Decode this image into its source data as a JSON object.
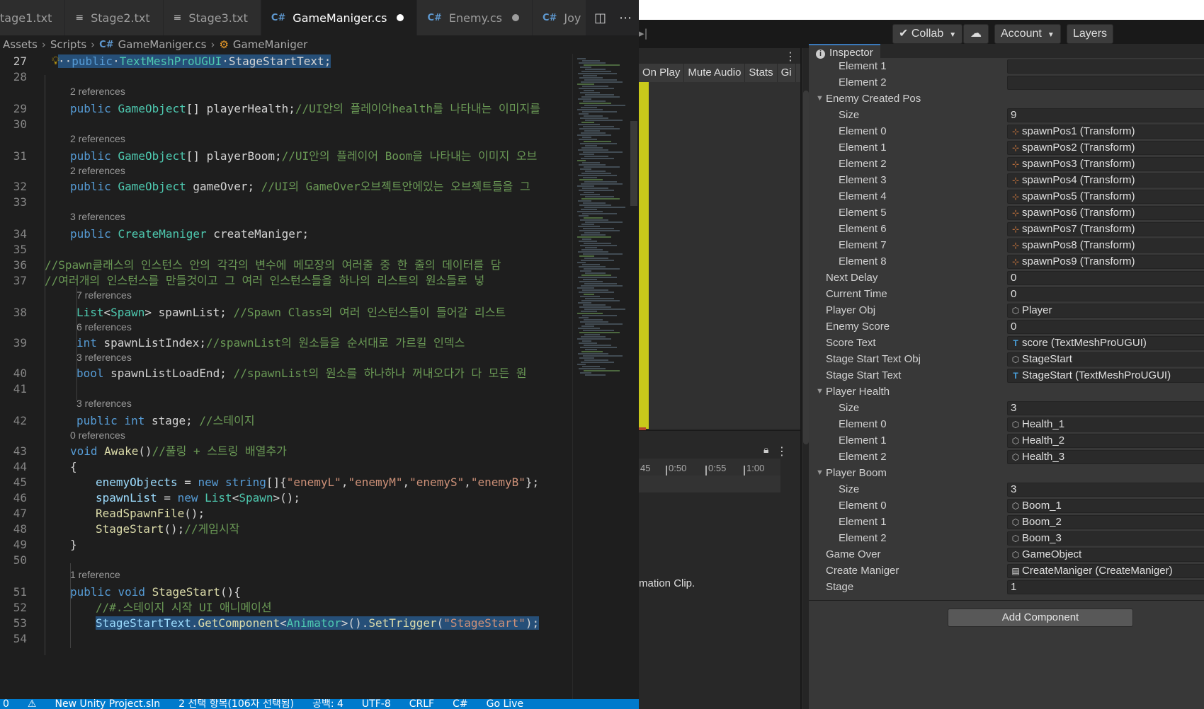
{
  "vscode": {
    "tabs": [
      {
        "label": "tage1.txt",
        "icon": "text-file-icon",
        "modified": false,
        "active": false
      },
      {
        "label": "Stage2.txt",
        "icon": "text-file-icon",
        "modified": false,
        "active": false
      },
      {
        "label": "Stage3.txt",
        "icon": "text-file-icon",
        "modified": false,
        "active": false
      },
      {
        "label": "GameManiger.cs",
        "icon": "csharp-file-icon",
        "modified": true,
        "active": true
      },
      {
        "label": "Enemy.cs",
        "icon": "csharp-file-icon",
        "modified": true,
        "active": false
      },
      {
        "label": "Joy",
        "icon": "csharp-file-icon",
        "modified": false,
        "active": false
      }
    ],
    "tab_icon_glyphs": {
      "txt": "≡",
      "cs": "C#"
    },
    "breadcrumb": {
      "root": "Assets",
      "folder": "Scripts",
      "file": "GameManiger.cs",
      "symbol": "GameManiger"
    },
    "lines": [
      {
        "num": "27",
        "lens": "",
        "html": "<span class=\"sel\">··<span class=\"kw\">public</span>·<span class=\"ty\">TextMeshProUGUI</span>·StageStartText;</span>",
        "indent": 82
      },
      {
        "num": "28",
        "lens": "",
        "html": "",
        "indent": 82
      },
      {
        "num": "29",
        "lens": "2 references",
        "html": "<span class=\"kw\">public</span> <span class=\"ty\">GameObject</span>[] playerHealth;<span class=\"cm\">//UI안의 플레이어health를 나타내는 이미지를</span>",
        "indent": 99
      },
      {
        "num": "30",
        "lens": "",
        "html": "",
        "indent": 99
      },
      {
        "num": "31",
        "lens": "2 references",
        "html": "<span class=\"kw\">public</span> <span class=\"ty\">GameObject</span>[] playerBoom;<span class=\"cm\">//UI안의 플레이어 Boom을 나타내는 이미지 오브</span>",
        "indent": 99
      },
      {
        "num": "32",
        "lens": "2 references",
        "html": "<span class=\"kw\">public</span> <span class=\"ty\">GameObject</span> gameOver; <span class=\"cm\">//UI의 GameOver오브젝트안에있는 오브젝트들을 그</span>",
        "indent": 99
      },
      {
        "num": "33",
        "lens": "",
        "html": "",
        "indent": 99
      },
      {
        "num": "34",
        "lens": "3 references",
        "html": "<span class=\"kw\">public</span> <span class=\"ty\">CreateManiger</span> createManiger;",
        "indent": 99
      },
      {
        "num": "35",
        "lens": "",
        "html": "",
        "indent": 99
      },
      {
        "num": "36",
        "lens": "",
        "html": "<span class=\"cm\">//Spawn클래스의 인스턴스 안의 각각의 변수에 메모장의 여러줄 중 한 줄의 데이터를 담</span>",
        "indent": 63
      },
      {
        "num": "37",
        "lens": "",
        "html": "<span class=\"cm\">//여러개의 인스턴스를 만들것이고 그 여러 인스턴스들을 하나의 리스트의 원소들로 넣</span>",
        "indent": 63
      },
      {
        "num": "38",
        "lens": "7 references",
        "html": "<span class=\"ty\">List</span>&lt;<span class=\"ty\">Spawn</span>&gt; spawnList; <span class=\"cm\">//Spawn Class의 여러 인스턴스들이 들어갈 리스트</span>",
        "indent": 108
      },
      {
        "num": "39",
        "lens": "6 references",
        "html": "<span class=\"kw\">int</span> spawnListIndex;<span class=\"cm\">//spawnList의 원소들을 순서대로 가르킬 인덱스</span>",
        "indent": 108
      },
      {
        "num": "40",
        "lens": "3 references",
        "html": "<span class=\"kw\">bool</span> spawnListLoadEnd; <span class=\"cm\">//spawnList의 원소를 하나하나 꺼내오다가 다 모든 원</span>",
        "indent": 108
      },
      {
        "num": "41",
        "lens": "",
        "html": "",
        "indent": 108
      },
      {
        "num": "42",
        "lens": "3 references",
        "html": "<span class=\"kw\">public</span> <span class=\"kw\">int</span> stage; <span class=\"cm\">//스테이지</span>",
        "indent": 108
      },
      {
        "num": "43",
        "lens": "0 references",
        "html": "<span class=\"kw\">void</span> <span class=\"fn\">Awake</span>()<span class=\"cm\">//풀링 + 스트링 배열추가</span>",
        "indent": 99
      },
      {
        "num": "44",
        "lens": "",
        "html": "{",
        "indent": 99
      },
      {
        "num": "45",
        "lens": "",
        "html": "<span class=\"vr\">enemyObjects</span> = <span class=\"kw\">new</span> <span class=\"kw\">string</span>[]{<span class=\"st\">\"enemyL\"</span>,<span class=\"st\">\"enemyM\"</span>,<span class=\"st\">\"enemyS\"</span>,<span class=\"st\">\"enemyB\"</span>};",
        "indent": 135
      },
      {
        "num": "46",
        "lens": "",
        "html": "<span class=\"vr\">spawnList</span> = <span class=\"kw\">new</span> <span class=\"ty\">List</span>&lt;<span class=\"ty\">Spawn</span>&gt;();",
        "indent": 135
      },
      {
        "num": "47",
        "lens": "",
        "html": "<span class=\"fn\">ReadSpawnFile</span>();",
        "indent": 135
      },
      {
        "num": "48",
        "lens": "",
        "html": "<span class=\"fn\">StageStart</span>();<span class=\"cm\">//게임시작</span>",
        "indent": 135
      },
      {
        "num": "49",
        "lens": "",
        "html": "}",
        "indent": 99
      },
      {
        "num": "50",
        "lens": "",
        "html": "",
        "indent": 99
      },
      {
        "num": "51",
        "lens": "1 reference",
        "html": "<span class=\"kw\">public</span> <span class=\"kw\">void</span> <span class=\"fn\">StageStart</span>(){",
        "indent": 99
      },
      {
        "num": "52",
        "lens": "",
        "html": "<span class=\"cm\">//#.스테이지 시작 UI 애니메이션</span>",
        "indent": 135
      },
      {
        "num": "53",
        "lens": "",
        "html": "<span class=\"sel\"><span class=\"vr\">StageStartText</span>.<span class=\"fn\">GetComponent</span>&lt;<span class=\"ty\">Animator</span>&gt;().<span class=\"fn\">SetTrigger</span>(<span class=\"st\">\"StageStart\"</span>);</span>",
        "indent": 135
      },
      {
        "num": "54",
        "lens": "",
        "html": "",
        "indent": 135
      }
    ],
    "status_items": [
      "0",
      "⚠",
      "New Unity Project.sln",
      "2 선택 항목(106자 선택됨)",
      "공백: 4",
      "UTF-8",
      "CRLF",
      "C#",
      "Go Live"
    ]
  },
  "unity": {
    "toolbar": {
      "collab": "Collab",
      "account": "Account",
      "layers": "Layers"
    },
    "game_toolbar": [
      "On Play",
      "Mute Audio",
      "Stats",
      "Gi"
    ],
    "timeline_ticks": [
      "45",
      "0:50",
      "0:55",
      "1:00"
    ],
    "animation_message": "mation Clip.",
    "inspector_tab": "Inspector",
    "properties": [
      {
        "label": "Element 1",
        "value": "",
        "depth": 2,
        "foldout": false,
        "icon": ""
      },
      {
        "label": "Element 2",
        "value": "",
        "depth": 2,
        "foldout": false,
        "icon": ""
      },
      {
        "label": "Enemy Created Pos",
        "value": null,
        "depth": 1,
        "foldout": true,
        "icon": ""
      },
      {
        "label": "Size",
        "value": "9",
        "depth": 2,
        "foldout": false,
        "icon": ""
      },
      {
        "label": "Element 0",
        "value": "spawnPos1 (Transform)",
        "depth": 2,
        "foldout": false,
        "icon": "transform"
      },
      {
        "label": "Element 1",
        "value": "spawnPos2 (Transform)",
        "depth": 2,
        "foldout": false,
        "icon": "transform"
      },
      {
        "label": "Element 2",
        "value": "spawnPos3 (Transform)",
        "depth": 2,
        "foldout": false,
        "icon": "transform"
      },
      {
        "label": "Element 3",
        "value": "spawnPos4 (Transform)",
        "depth": 2,
        "foldout": false,
        "icon": "transform"
      },
      {
        "label": "Element 4",
        "value": "spawnPos5 (Transform)",
        "depth": 2,
        "foldout": false,
        "icon": "transform"
      },
      {
        "label": "Element 5",
        "value": "spawnPos6 (Transform)",
        "depth": 2,
        "foldout": false,
        "icon": "transform"
      },
      {
        "label": "Element 6",
        "value": "spawnPos7 (Transform)",
        "depth": 2,
        "foldout": false,
        "icon": "transform"
      },
      {
        "label": "Element 7",
        "value": "spawnPos8 (Transform)",
        "depth": 2,
        "foldout": false,
        "icon": "transform"
      },
      {
        "label": "Element 8",
        "value": "spawnPos9 (Transform)",
        "depth": 2,
        "foldout": false,
        "icon": "transform"
      },
      {
        "label": "Next Delay",
        "value": "0",
        "depth": 1,
        "foldout": false,
        "icon": ""
      },
      {
        "label": "Current Time",
        "value": "0",
        "depth": 1,
        "foldout": false,
        "icon": ""
      },
      {
        "label": "Player Obj",
        "value": "Player",
        "depth": 1,
        "foldout": false,
        "icon": "gameobject"
      },
      {
        "label": "Enemy Score",
        "value": "0",
        "depth": 1,
        "foldout": false,
        "icon": ""
      },
      {
        "label": "Score Text",
        "value": "score (TextMeshProUGUI)",
        "depth": 1,
        "foldout": false,
        "icon": "textmesh"
      },
      {
        "label": "Stage Start Text Obj",
        "value": "StageStart",
        "depth": 1,
        "foldout": false,
        "icon": "gameobject"
      },
      {
        "label": "Stage Start Text",
        "value": "StageStart (TextMeshProUGUI)",
        "depth": 1,
        "foldout": false,
        "icon": "textmesh"
      },
      {
        "label": "Player Health",
        "value": null,
        "depth": 1,
        "foldout": true,
        "icon": ""
      },
      {
        "label": "Size",
        "value": "3",
        "depth": 2,
        "foldout": false,
        "icon": ""
      },
      {
        "label": "Element 0",
        "value": "Health_1",
        "depth": 2,
        "foldout": false,
        "icon": "gameobject"
      },
      {
        "label": "Element 1",
        "value": "Health_2",
        "depth": 2,
        "foldout": false,
        "icon": "gameobject"
      },
      {
        "label": "Element 2",
        "value": "Health_3",
        "depth": 2,
        "foldout": false,
        "icon": "gameobject"
      },
      {
        "label": "Player Boom",
        "value": null,
        "depth": 1,
        "foldout": true,
        "icon": ""
      },
      {
        "label": "Size",
        "value": "3",
        "depth": 2,
        "foldout": false,
        "icon": ""
      },
      {
        "label": "Element 0",
        "value": "Boom_1",
        "depth": 2,
        "foldout": false,
        "icon": "gameobject"
      },
      {
        "label": "Element 1",
        "value": "Boom_2",
        "depth": 2,
        "foldout": false,
        "icon": "gameobject"
      },
      {
        "label": "Element 2",
        "value": "Boom_3",
        "depth": 2,
        "foldout": false,
        "icon": "gameobject"
      },
      {
        "label": "Game Over",
        "value": "GameObject",
        "depth": 1,
        "foldout": false,
        "icon": "gameobject"
      },
      {
        "label": "Create Maniger",
        "value": "CreateManiger (CreateManiger)",
        "depth": 1,
        "foldout": false,
        "icon": "script"
      },
      {
        "label": "Stage",
        "value": "1",
        "depth": 1,
        "foldout": false,
        "icon": ""
      }
    ],
    "add_component": "Add Component",
    "icon_glyphs": {
      "transform": "⊹",
      "gameobject": "⬡",
      "textmesh": "T",
      "script": "▤"
    }
  }
}
